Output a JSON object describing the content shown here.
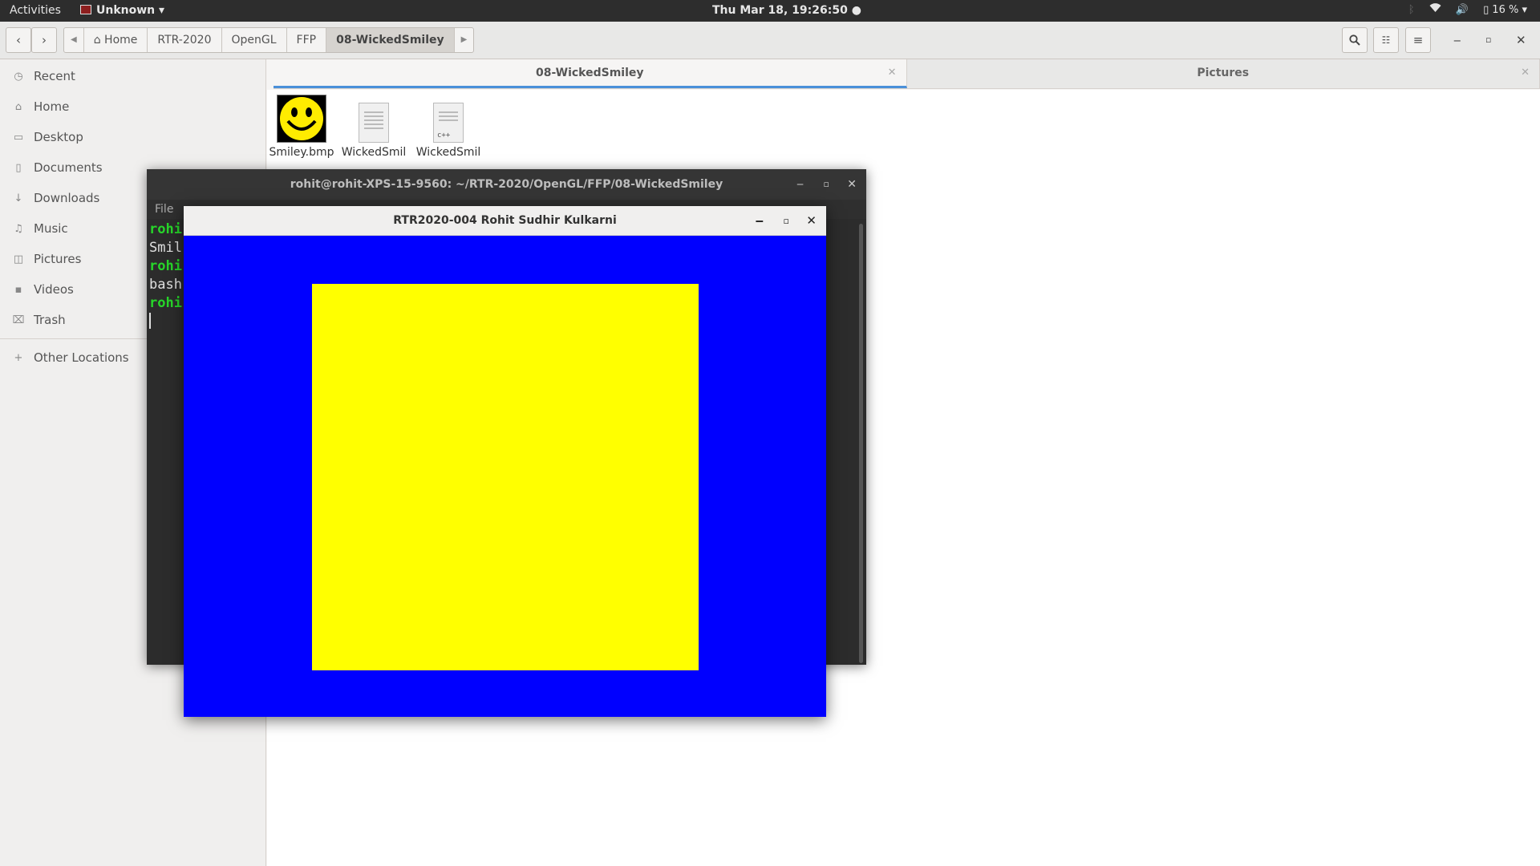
{
  "topbar": {
    "activities": "Activities",
    "app_name": "Unknown",
    "clock": "Thu Mar 18, 19:26:50 ●",
    "battery": "16 %"
  },
  "files": {
    "breadcrumbs": [
      "Home",
      "RTR-2020",
      "OpenGL",
      "FFP",
      "08-WickedSmiley"
    ],
    "sidebar": [
      {
        "label": "Recent",
        "icon": "clock-icon"
      },
      {
        "label": "Home",
        "icon": "home-icon"
      },
      {
        "label": "Desktop",
        "icon": "folder-icon"
      },
      {
        "label": "Documents",
        "icon": "document-icon"
      },
      {
        "label": "Downloads",
        "icon": "download-icon"
      },
      {
        "label": "Music",
        "icon": "music-icon"
      },
      {
        "label": "Pictures",
        "icon": "camera-icon"
      },
      {
        "label": "Videos",
        "icon": "video-icon"
      },
      {
        "label": "Trash",
        "icon": "trash-icon"
      }
    ],
    "other_locations": "Other Locations",
    "tabs": [
      {
        "label": "08-WickedSmiley",
        "active": true
      },
      {
        "label": "Pictures",
        "active": false
      }
    ],
    "items": [
      {
        "name": "Smiley.bmp"
      },
      {
        "name": "WickedSmil ey"
      },
      {
        "name": "WickedSmil ey.cpp"
      }
    ]
  },
  "terminal": {
    "title": "rohit@rohit-XPS-15-9560: ~/RTR-2020/OpenGL/FFP/08-WickedSmiley",
    "menu_file": "File",
    "lines": [
      {
        "text": "rohi",
        "green": true
      },
      {
        "text": "Smil",
        "green": false
      },
      {
        "text": "rohi",
        "green": true
      },
      {
        "text": "bash",
        "green": false
      },
      {
        "text": "rohi",
        "green": true
      }
    ]
  },
  "glwindow": {
    "title": "RTR2020-004 Rohit Sudhir Kulkarni",
    "background_color": "#0000ff",
    "quad_color": "#ffff00"
  }
}
